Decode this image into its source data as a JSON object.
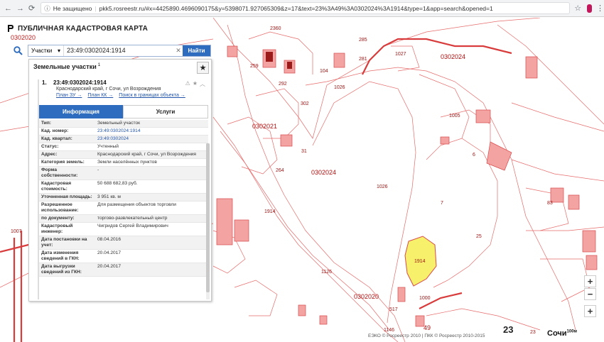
{
  "browser": {
    "security_label": "Не защищено",
    "url": "pkk5.rosreestr.ru/#x=4425890.4696090175&y=5398071.927065309&z=17&text=23%3A49%3A0302024%3A1914&type=1&app=search&opened=1"
  },
  "app": {
    "title": "ПУБЛИЧНАЯ КАДАСТРОВАЯ КАРТА",
    "quarter_code": "0302020"
  },
  "search": {
    "type_label": "Участки",
    "query": "23:49:0302024:1914",
    "button_label": "Найти"
  },
  "panel": {
    "title": "Земельные участки",
    "count": "1",
    "item": {
      "number": "1.",
      "cad_number": "23:49:0302024:1914",
      "address": "Краснодарский край, г Сочи, ул Возрождения",
      "links": [
        "План ЗУ →",
        "План КК →",
        "Поиск в границах объекта →"
      ]
    },
    "tabs": {
      "info": "Информация",
      "services": "Услуги"
    },
    "rows": [
      {
        "key": "Тип:",
        "val": "Земельный участок"
      },
      {
        "key": "Кад. номер:",
        "val": "23:49:0302024:1914"
      },
      {
        "key": "Кад. квартал:",
        "val": "23:49:0302024"
      },
      {
        "key": "Статус:",
        "val": "Учтенный"
      },
      {
        "key": "Адрес:",
        "val": "Краснодарский край, г Сочи, ул Возрождения"
      },
      {
        "key": "Категория земель:",
        "val": "Земли населённых пунктов"
      },
      {
        "key": "Форма собственности:",
        "val": "-"
      },
      {
        "key": "Кадастровая стоимость:",
        "val": "50 688 682,83 руб."
      },
      {
        "key": "Уточненная площадь:",
        "val": "3 951 кв. м"
      },
      {
        "key": "Разрешенное использование:",
        "val": "Для размещения объектов торговли"
      },
      {
        "key": "по документу:",
        "val": "торгово-развлекательный центр"
      },
      {
        "key": "Кадастровый инженер:",
        "val": "Чигридов Сергей Владимирович"
      },
      {
        "key": "Дата постановки на учет:",
        "val": "08.04.2016"
      },
      {
        "key": "Дата изменения сведений в ГКН:",
        "val": "20.04.2017"
      },
      {
        "key": "Дата выгрузки сведений из ГКН:",
        "val": "20.04.2017"
      }
    ]
  },
  "map": {
    "labels": [
      "2360",
      "0302024",
      "1027",
      "1026",
      "1026",
      "0302024",
      "0302021",
      "1914",
      "1914",
      "6",
      "7",
      "25",
      "83",
      "1005",
      "1000",
      "1146",
      "49",
      "23",
      "1007",
      "259",
      "292",
      "302",
      "104",
      "285",
      "281",
      "31",
      "264",
      "1126",
      "517",
      "0302020"
    ],
    "city": "Сочи",
    "scale": "100м",
    "big_number": "23",
    "footer": "ЕЭКО © Росреестр 2010 | ПКК © Росреестр 2010-2015"
  },
  "colors": {
    "accent": "#2e6cc0",
    "parcel_line": "#e05a5a",
    "highlight_parcel": "#f6f06a",
    "building_fill": "#f4a3a3"
  }
}
